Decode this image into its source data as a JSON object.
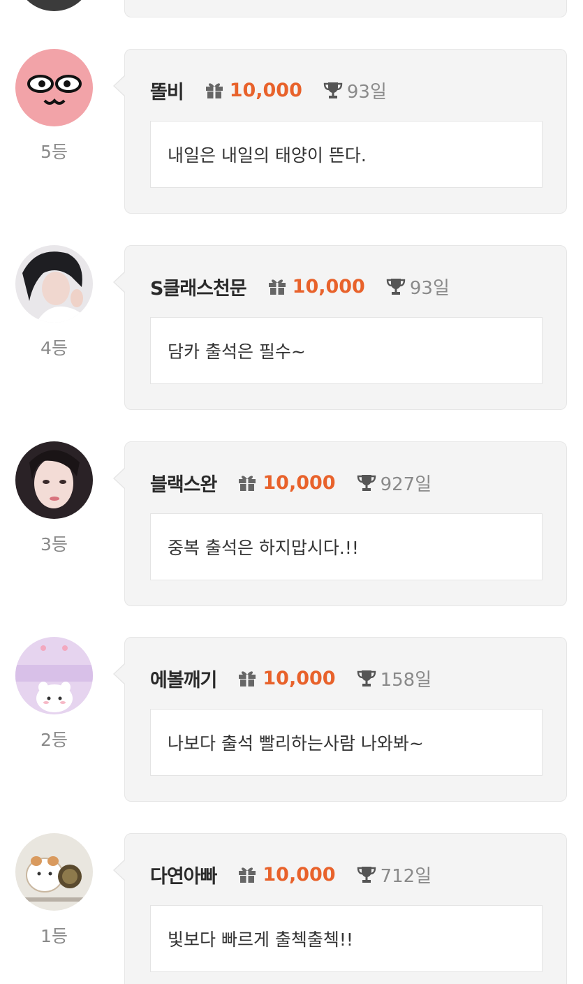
{
  "entries": [
    {
      "rank": "5등",
      "nickname": "똘비",
      "points": "10,000",
      "days": "93일",
      "message": "내일은 내일의 태양이 뜬다."
    },
    {
      "rank": "4등",
      "nickname": "S클래스천문",
      "points": "10,000",
      "days": "93일",
      "message": "담카 출석은 필수~"
    },
    {
      "rank": "3등",
      "nickname": "블랙스완",
      "points": "10,000",
      "days": "927일",
      "message": "중복 출석은 하지맙시다.!!"
    },
    {
      "rank": "2등",
      "nickname": "에볼깨기",
      "points": "10,000",
      "days": "158일",
      "message": "나보다 출석 빨리하는사람 나와봐~"
    },
    {
      "rank": "1등",
      "nickname": "다연아빠",
      "points": "10,000",
      "days": "712일",
      "message": "빛보다 빠르게 출첵출첵!!"
    }
  ],
  "colors": {
    "accent": "#e8622b",
    "muted": "#8a8a8a",
    "card_bg": "#f4f4f4"
  },
  "icons": {
    "points": "gift-icon",
    "streak": "trophy-icon"
  }
}
